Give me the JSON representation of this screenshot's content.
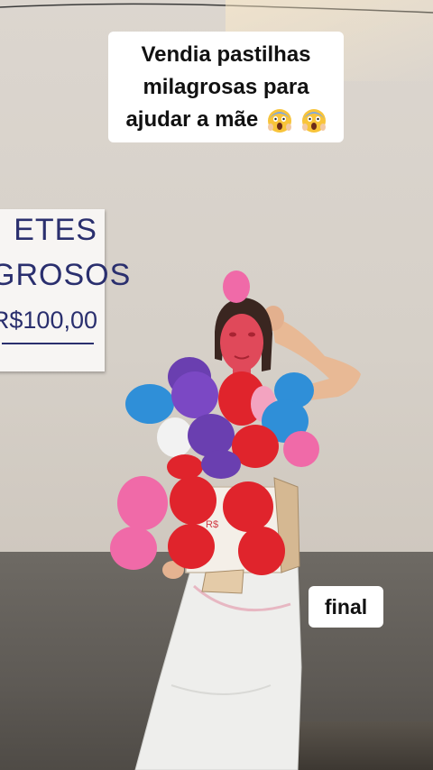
{
  "caption": {
    "line1": "Vendia pastilhas",
    "line2": "milagrosas para",
    "line3": "ajudar a mãe",
    "emoji": "screaming-face-emoji"
  },
  "sign": {
    "line1": "ETES",
    "line2": "GROSOS",
    "line3": "R$100,00"
  },
  "badge": {
    "label": "final"
  },
  "colors": {
    "wall": "#d6d0c8",
    "balloon_red": "#e0242c",
    "balloon_purple": "#6a3fb0",
    "balloon_blue": "#2f8fd8",
    "balloon_pink": "#f06aa8",
    "caption_bg": "#ffffff"
  }
}
